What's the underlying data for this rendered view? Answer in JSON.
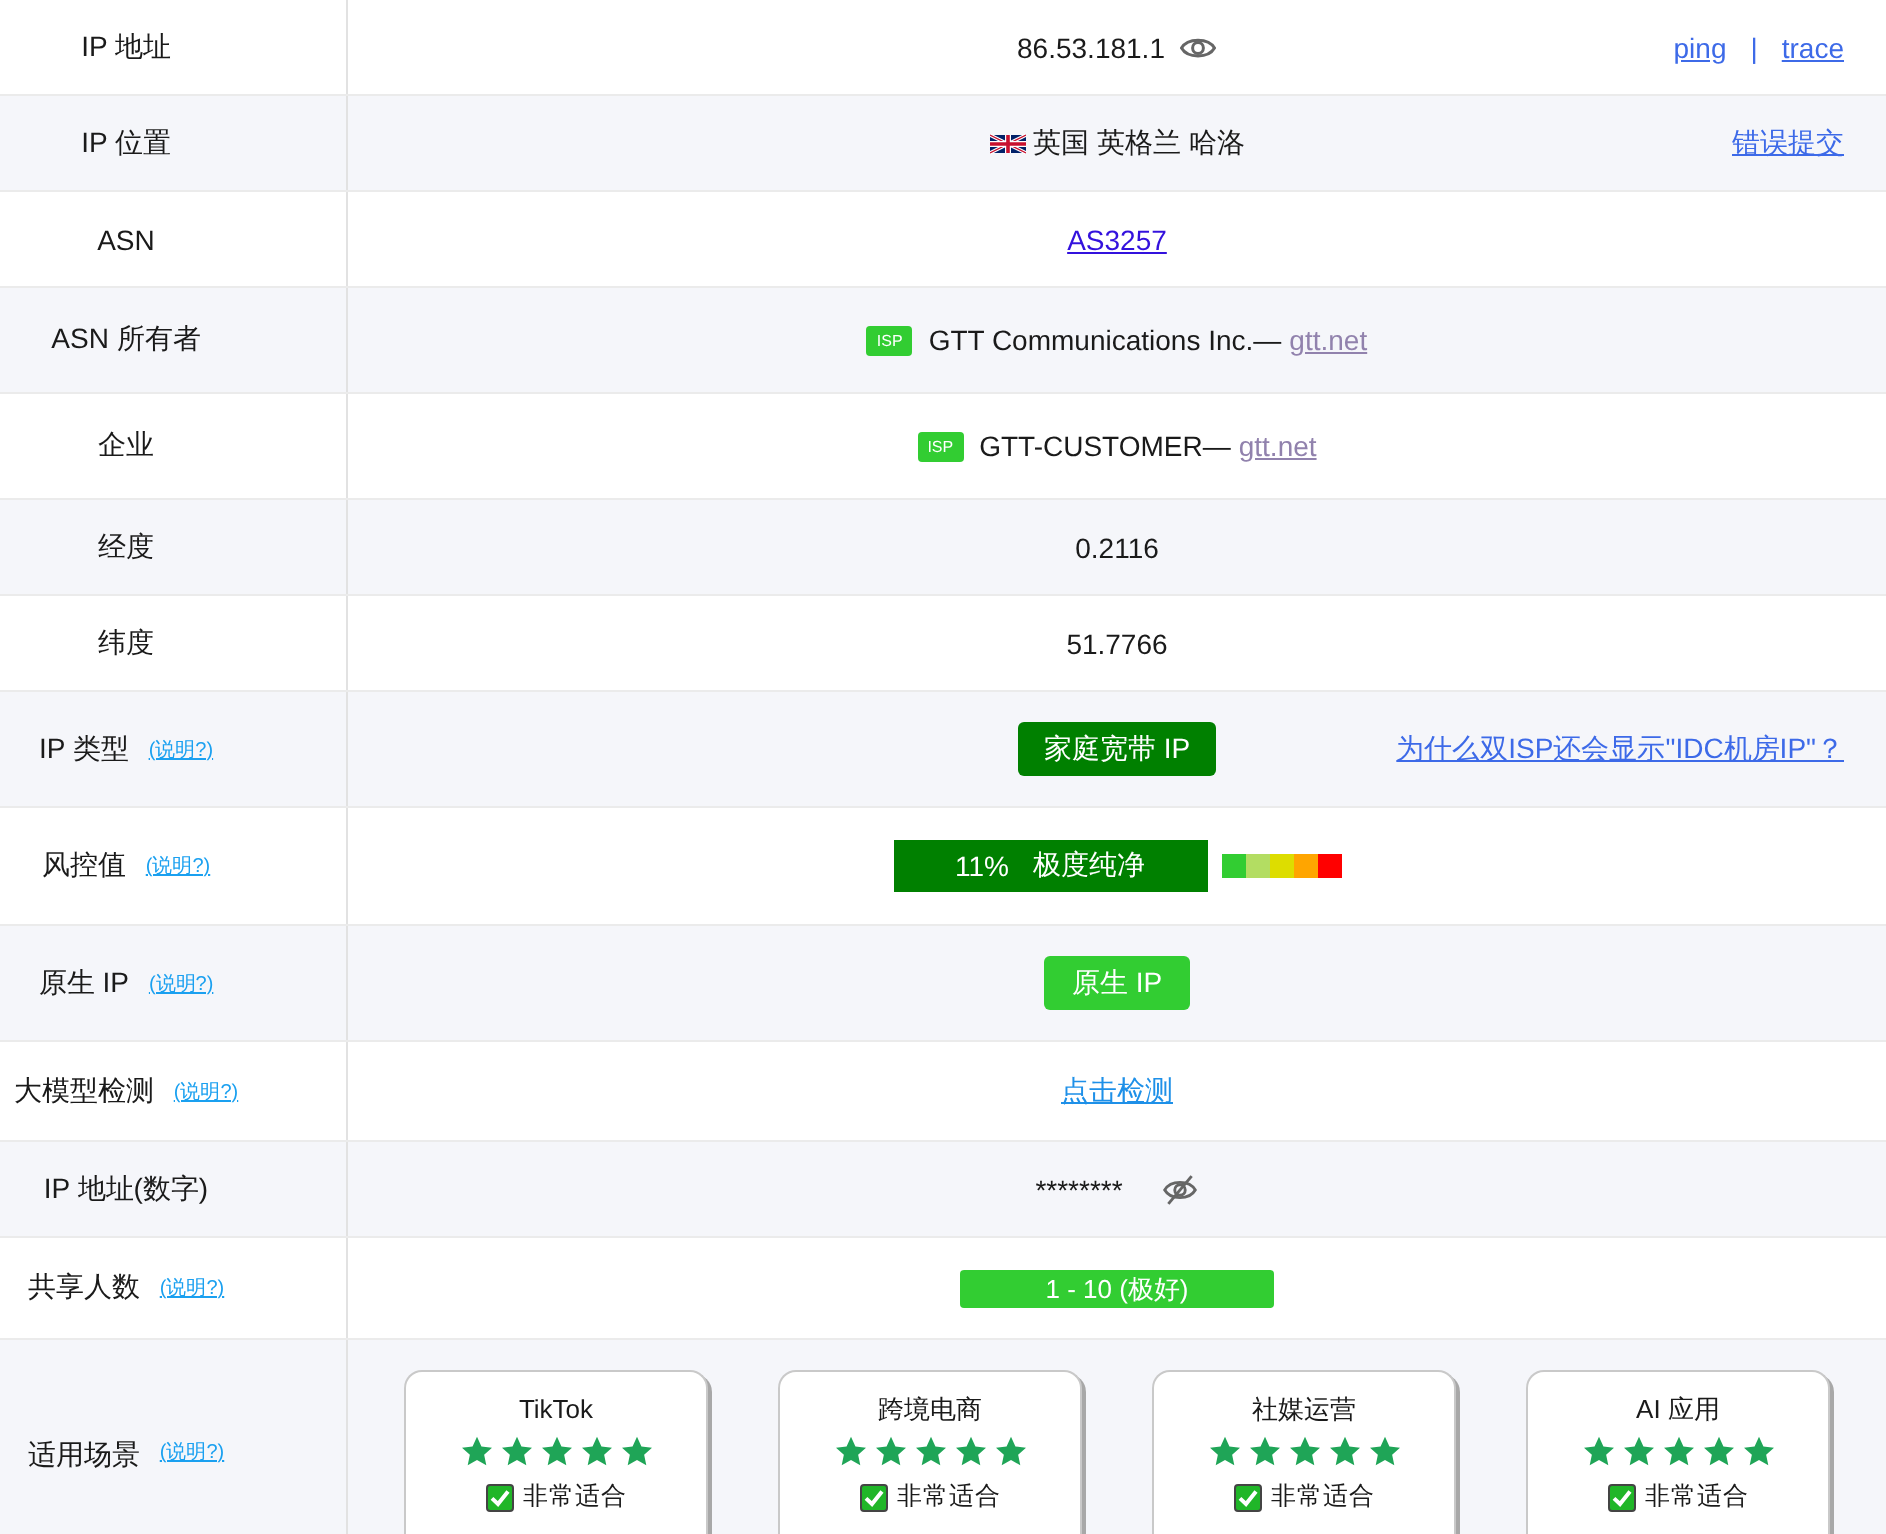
{
  "rows": [
    {
      "kind": "ip",
      "label": "IP 地址",
      "value": "86.53.181.1",
      "links": [
        "ping",
        "trace"
      ],
      "separator": "|"
    },
    {
      "kind": "location",
      "label": "IP 位置",
      "value": "英国 英格兰 哈洛",
      "link": "错误提交"
    },
    {
      "kind": "asn",
      "label": "ASN",
      "link": "AS3257"
    },
    {
      "kind": "isp",
      "label": "ASN 所有者",
      "badge": "ISP",
      "value": "GTT Communications Inc.—",
      "link": "gtt.net"
    },
    {
      "kind": "isp",
      "label": "企业",
      "badge": "ISP",
      "value": "GTT-CUSTOMER—",
      "link": "gtt.net"
    },
    {
      "kind": "text",
      "label": "经度",
      "value": "0.2116"
    },
    {
      "kind": "text",
      "label": "纬度",
      "value": "51.7766"
    },
    {
      "kind": "type",
      "label": "IP 类型",
      "help": "(说明?)",
      "badge": "家庭宽带 IP",
      "link": "为什么双ISP还会显示\"IDC机房IP\"？"
    },
    {
      "kind": "risk",
      "label": "风控值",
      "help": "(说明?)",
      "percent": "11%",
      "verdict": "极度纯净"
    },
    {
      "kind": "native",
      "label": "原生 IP",
      "help": "(说明?)",
      "badge": "原生 IP"
    },
    {
      "kind": "action",
      "label": "大模型检测",
      "help": "(说明?)",
      "link": "点击检测"
    },
    {
      "kind": "masked",
      "label": "IP 地址(数字)",
      "value": "********"
    },
    {
      "kind": "shared",
      "label": "共享人数",
      "help": "(说明?)",
      "badge": "1 - 10 (极好)"
    },
    {
      "kind": "scenes",
      "label": "适用场景",
      "help": "(说明?)",
      "cards": [
        {
          "title": "TikTok",
          "stars": 5,
          "checked": true,
          "verdict": "非常适合"
        },
        {
          "title": "跨境电商",
          "stars": 5,
          "checked": true,
          "verdict": "非常适合"
        },
        {
          "title": "社媒运营",
          "stars": 5,
          "checked": true,
          "verdict": "非常适合"
        },
        {
          "title": "AI 应用",
          "stars": 5,
          "checked": true,
          "verdict": "非常适合"
        }
      ]
    }
  ]
}
